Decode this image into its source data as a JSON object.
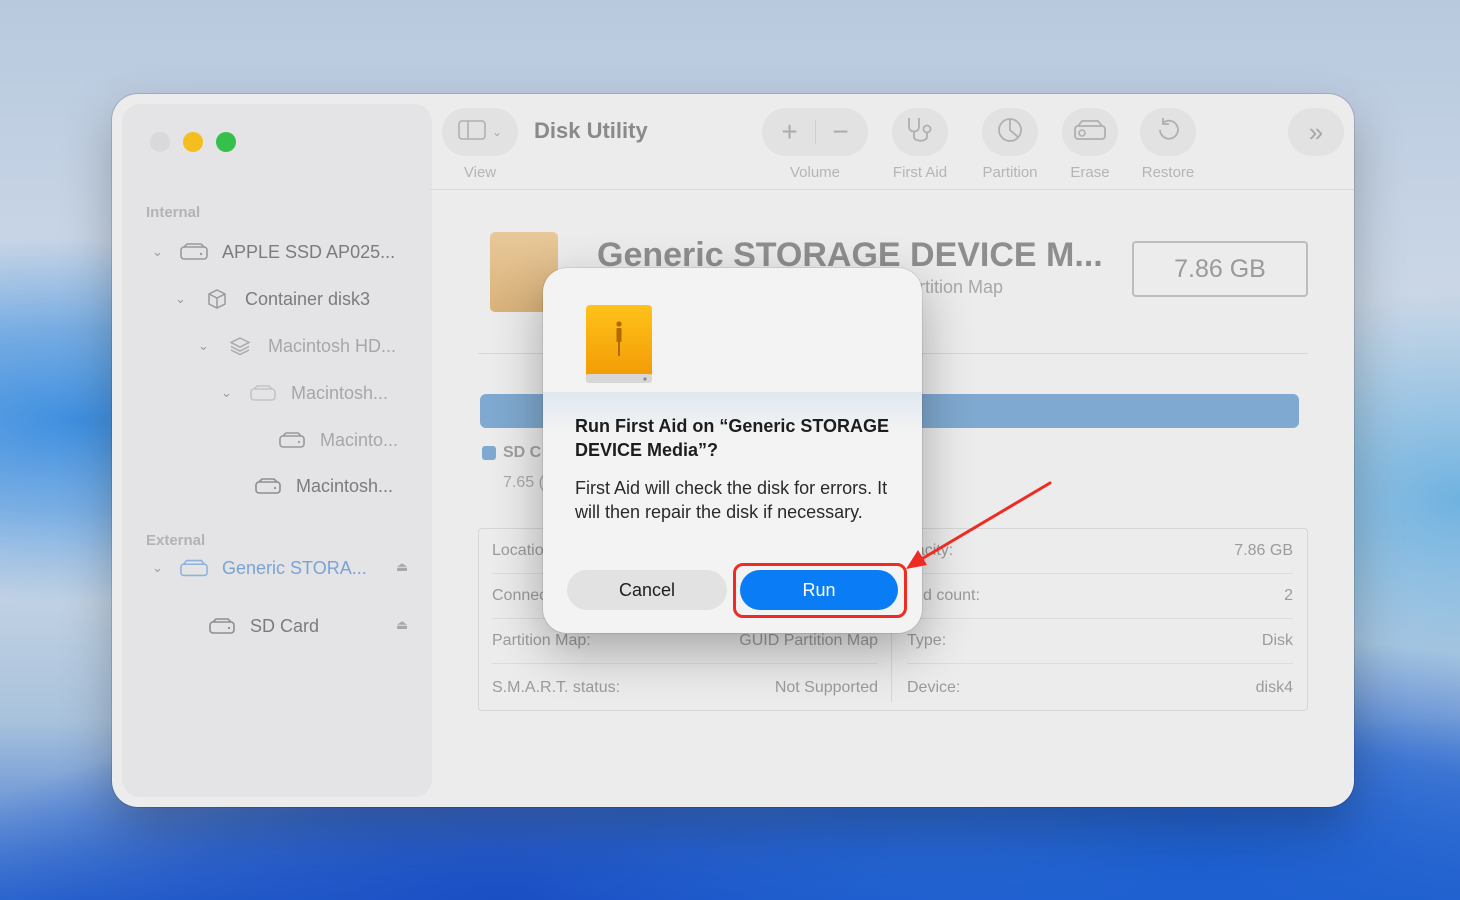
{
  "window": {
    "title": "Disk Utility"
  },
  "toolbar": {
    "view_label": "View",
    "volume_label": "Volume",
    "first_aid_label": "First Aid",
    "partition_label": "Partition",
    "erase_label": "Erase",
    "restore_label": "Restore"
  },
  "sidebar": {
    "internal_header": "Internal",
    "external_header": "External",
    "items": [
      {
        "label": "APPLE SSD AP025...",
        "icon": "internal-drive-icon"
      },
      {
        "label": "Container disk3",
        "icon": "container-icon"
      },
      {
        "label": "Macintosh HD...",
        "icon": "volume-stack-icon"
      },
      {
        "label": "Macintosh...",
        "icon": "drive-icon"
      },
      {
        "label": "Macinto...",
        "icon": "drive-icon"
      },
      {
        "label": "Macintosh...",
        "icon": "drive-icon"
      },
      {
        "label": "Generic STORA...",
        "icon": "external-drive-icon",
        "selected": true
      },
      {
        "label": "SD Card",
        "icon": "drive-icon"
      }
    ]
  },
  "content": {
    "disk_name": "Generic STORAGE DEVICE M...",
    "disk_sub": "artition Map",
    "size": "7.86 GB",
    "legend_label": "SD C",
    "legend_value": "7.65 (",
    "info": {
      "left": [
        {
          "label": "Locatio",
          "value": ""
        },
        {
          "label": "Connec",
          "value": ""
        },
        {
          "label": "Partition Map:",
          "value": "GUID Partition Map"
        },
        {
          "label": "S.M.A.R.T. status:",
          "value": "Not Supported"
        }
      ],
      "right": [
        {
          "label": "pacity:",
          "value": "7.86 GB"
        },
        {
          "label": "hild count:",
          "value": "2"
        },
        {
          "label": "Type:",
          "value": "Disk"
        },
        {
          "label": "Device:",
          "value": "disk4"
        }
      ]
    }
  },
  "dialog": {
    "title": "Run First Aid on “Generic STORAGE DEVICE Media”?",
    "message": "First Aid will check the disk for errors. It will then repair the disk if necessary.",
    "cancel_label": "Cancel",
    "run_label": "Run"
  },
  "colors": {
    "accent": "#0a7cf5",
    "annotation": "#ee2c24",
    "selected_text": "#7aa3d4"
  }
}
